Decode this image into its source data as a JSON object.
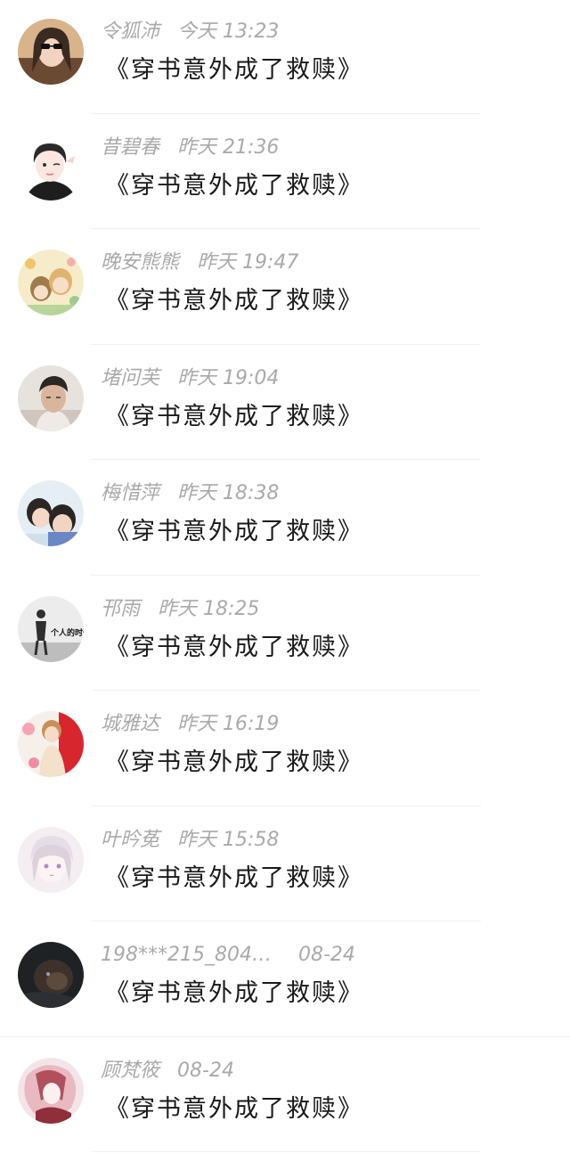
{
  "comments": [
    {
      "name": "令狐沛",
      "time": "今天  13:23",
      "message": "《穿书意外成了救赎》",
      "avatar_colors": [
        "#c9a37c",
        "#3a2b22"
      ]
    },
    {
      "name": "昔碧春",
      "time": "昨天  21:36",
      "message": "《穿书意外成了救赎》",
      "avatar_colors": [
        "#f3ddd6",
        "#2a2a2a"
      ]
    },
    {
      "name": "晚安熊熊",
      "time": "昨天  19:47",
      "message": "《穿书意外成了救赎》",
      "avatar_colors": [
        "#f1e2b0",
        "#a07c4c"
      ]
    },
    {
      "name": "堵问芙",
      "time": "昨天  19:04",
      "message": "《穿书意外成了救赎》",
      "avatar_colors": [
        "#d9d2cc",
        "#3b3330"
      ]
    },
    {
      "name": "梅惜萍",
      "time": "昨天  18:38",
      "message": "《穿书意外成了救赎》",
      "avatar_colors": [
        "#dbe6ee",
        "#2c2724"
      ]
    },
    {
      "name": "邗雨",
      "time": "昨天  18:25",
      "message": "《穿书意外成了救赎》",
      "avatar_colors": [
        "#e6e6e6",
        "#2f2f2f"
      ],
      "avatar_caption": "个人的时候"
    },
    {
      "name": "城雅达",
      "time": "昨天  16:19",
      "message": "《穿书意外成了救赎》",
      "avatar_colors": [
        "#e03a3a",
        "#f2d8b8"
      ]
    },
    {
      "name": "叶昑莬",
      "time": "昨天  15:58",
      "message": "《穿书意外成了救赎》",
      "avatar_colors": [
        "#efe8ef",
        "#c3a6c7"
      ]
    },
    {
      "name": "198***215_804…",
      "time": "08-24",
      "message": "《穿书意外成了救赎》",
      "avatar_colors": [
        "#232527",
        "#5d4a3e"
      ]
    },
    {
      "name": "顾梵筱",
      "time": "08-24",
      "message": "《穿书意外成了救赎》",
      "avatar_colors": [
        "#f1d9de",
        "#b0505b"
      ]
    }
  ]
}
